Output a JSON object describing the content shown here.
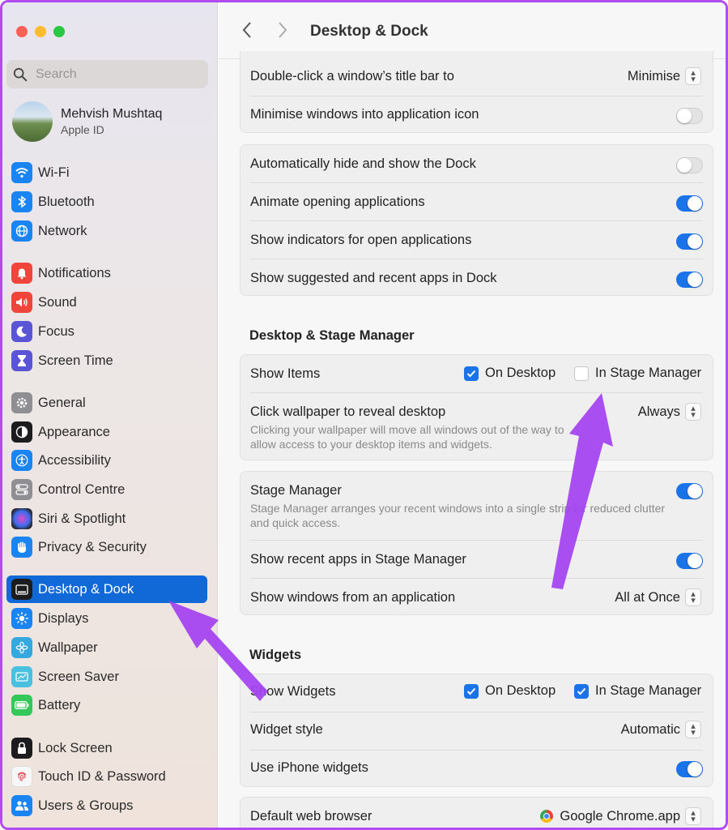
{
  "window": {
    "title": "Desktop & Dock"
  },
  "search": {
    "placeholder": "Search"
  },
  "profile": {
    "name": "Mehvish Mushtaq",
    "subtitle": "Apple ID"
  },
  "sidebar": {
    "items": [
      {
        "label": "Wi-Fi",
        "icon": "wifi-icon",
        "color": "#1a84f2"
      },
      {
        "label": "Bluetooth",
        "icon": "bluetooth-icon",
        "color": "#1a84f2"
      },
      {
        "label": "Network",
        "icon": "globe-icon",
        "color": "#1a84f2"
      },
      {
        "label": "Notifications",
        "icon": "bell-icon",
        "color": "#f0453a"
      },
      {
        "label": "Sound",
        "icon": "speaker-icon",
        "color": "#f0453a"
      },
      {
        "label": "Focus",
        "icon": "moon-icon",
        "color": "#5a55d6"
      },
      {
        "label": "Screen Time",
        "icon": "hourglass-icon",
        "color": "#5a55d6"
      },
      {
        "label": "General",
        "icon": "gear-icon",
        "color": "#8e8e93"
      },
      {
        "label": "Appearance",
        "icon": "appearance-icon",
        "color": "#1c1c1e"
      },
      {
        "label": "Accessibility",
        "icon": "accessibility-icon",
        "color": "#1a84f2"
      },
      {
        "label": "Control Centre",
        "icon": "control-centre-icon",
        "color": "#8e8e93"
      },
      {
        "label": "Siri & Spotlight",
        "icon": "siri-icon",
        "color": "#2b2b3a"
      },
      {
        "label": "Privacy & Security",
        "icon": "hand-icon",
        "color": "#1a84f2"
      },
      {
        "label": "Desktop & Dock",
        "icon": "dock-icon",
        "color": "#1c1c1e"
      },
      {
        "label": "Displays",
        "icon": "sun-icon",
        "color": "#1a84f2"
      },
      {
        "label": "Wallpaper",
        "icon": "flower-icon",
        "color": "#35a8e0"
      },
      {
        "label": "Screen Saver",
        "icon": "screen-saver-icon",
        "color": "#4ac0e0"
      },
      {
        "label": "Battery",
        "icon": "battery-icon",
        "color": "#34c759"
      },
      {
        "label": "Lock Screen",
        "icon": "lock-icon",
        "color": "#1c1c1e"
      },
      {
        "label": "Touch ID & Password",
        "icon": "fingerprint-icon",
        "color": "#f2f2f2"
      },
      {
        "label": "Users & Groups",
        "icon": "users-icon",
        "color": "#1a84f2"
      }
    ]
  },
  "main": {
    "group1": {
      "double_click_label": "Double-click a window’s title bar to",
      "double_click_value": "Minimise",
      "minimise_label": "Minimise windows into application icon",
      "minimise_on": false
    },
    "group2": {
      "auto_hide_label": "Automatically hide and show the Dock",
      "auto_hide_on": false,
      "animate_label": "Animate opening applications",
      "animate_on": true,
      "indicators_label": "Show indicators for open applications",
      "indicators_on": true,
      "suggested_label": "Show suggested and recent apps in Dock",
      "suggested_on": true
    },
    "stage_section_title": "Desktop & Stage Manager",
    "group3": {
      "show_items_label": "Show Items",
      "on_desktop_label": "On Desktop",
      "on_desktop_checked": true,
      "in_stage_label": "In Stage Manager",
      "in_stage_checked": false,
      "click_wallpaper_label": "Click wallpaper to reveal desktop",
      "click_wallpaper_desc": "Clicking your wallpaper will move all windows out of the way to allow access to your desktop items and widgets.",
      "click_wallpaper_value": "Always"
    },
    "group4": {
      "stage_manager_label": "Stage Manager",
      "stage_manager_desc": "Stage Manager arranges your recent windows into a single strip for reduced clutter and quick access.",
      "stage_manager_on": true,
      "recent_apps_label": "Show recent apps in Stage Manager",
      "recent_apps_on": true,
      "windows_from_app_label": "Show windows from an application",
      "windows_from_app_value": "All at Once"
    },
    "widgets_section_title": "Widgets",
    "group5": {
      "show_widgets_label": "Show Widgets",
      "on_desktop_label": "On Desktop",
      "on_desktop_checked": true,
      "in_stage_label": "In Stage Manager",
      "in_stage_checked": true,
      "widget_style_label": "Widget style",
      "widget_style_value": "Automatic",
      "iphone_widgets_label": "Use iPhone widgets",
      "iphone_widgets_on": true
    },
    "group6": {
      "browser_label": "Default web browser",
      "browser_value": "Google Chrome.app"
    }
  },
  "annotation": {
    "arrow_color": "#a445f0"
  }
}
